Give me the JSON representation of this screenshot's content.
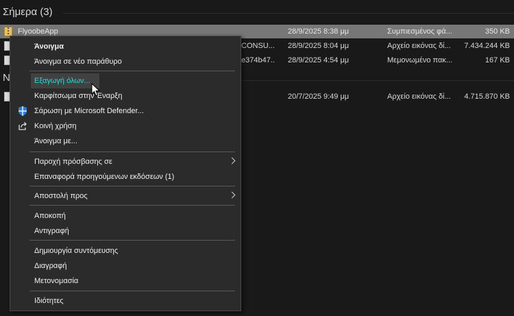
{
  "explorer": {
    "group_today": "Σήμερα (3)",
    "group_other": "N",
    "rows": [
      {
        "name": "FlyoobeApp",
        "name_part": "",
        "date": "28/9/2025 8:38 μμ",
        "type": "Συμπιεσμένος φά...",
        "size": "350 KB",
        "icon": "zip-folder-icon"
      },
      {
        "name": "",
        "name_part": "CONSU...",
        "date": "28/9/2025 8:04 μμ",
        "type": "Αρχείο εικόνας δί...",
        "size": "7.434.244 KB",
        "icon": "disc-image-icon"
      },
      {
        "name": "",
        "name_part": "e374b47...",
        "date": "28/9/2025 4:54 μμ",
        "type": "Μεμονωμένο πακ...",
        "size": "167 KB",
        "icon": "package-icon"
      },
      {
        "name": "",
        "name_part": "",
        "date": "20/7/2025 9:49 μμ",
        "type": "Αρχείο εικόνας δί...",
        "size": "4.715.870 KB",
        "icon": "disc-image-icon"
      }
    ]
  },
  "menu": {
    "open": "Άνοιγμα",
    "open_new_window": "Άνοιγμα σε νέο παράθυρο",
    "extract_all": "Εξαγωγή όλων...",
    "pin_start": "Καρφίτσωμα στην Έναρξη",
    "defender_scan": "Σάρωση με Microsoft Defender...",
    "share": "Κοινή χρήση",
    "open_with": "Άνοιγμα με...",
    "give_access": "Παροχή πρόσβασης σε",
    "restore_versions": "Επαναφορά προηγούμενων εκδόσεων (1)",
    "send_to": "Αποστολή προς",
    "cut": "Αποκοπή",
    "copy": "Αντιγραφή",
    "create_shortcut": "Δημιουργία συντόμευσης",
    "delete": "Διαγραφή",
    "rename": "Μετονομασία",
    "properties": "Ιδιότητες"
  },
  "colors": {
    "accent_highlight_text": "#18e0d8",
    "selected_row": "#777777",
    "menu_bg": "#2b2b2b",
    "background": "#191919"
  }
}
